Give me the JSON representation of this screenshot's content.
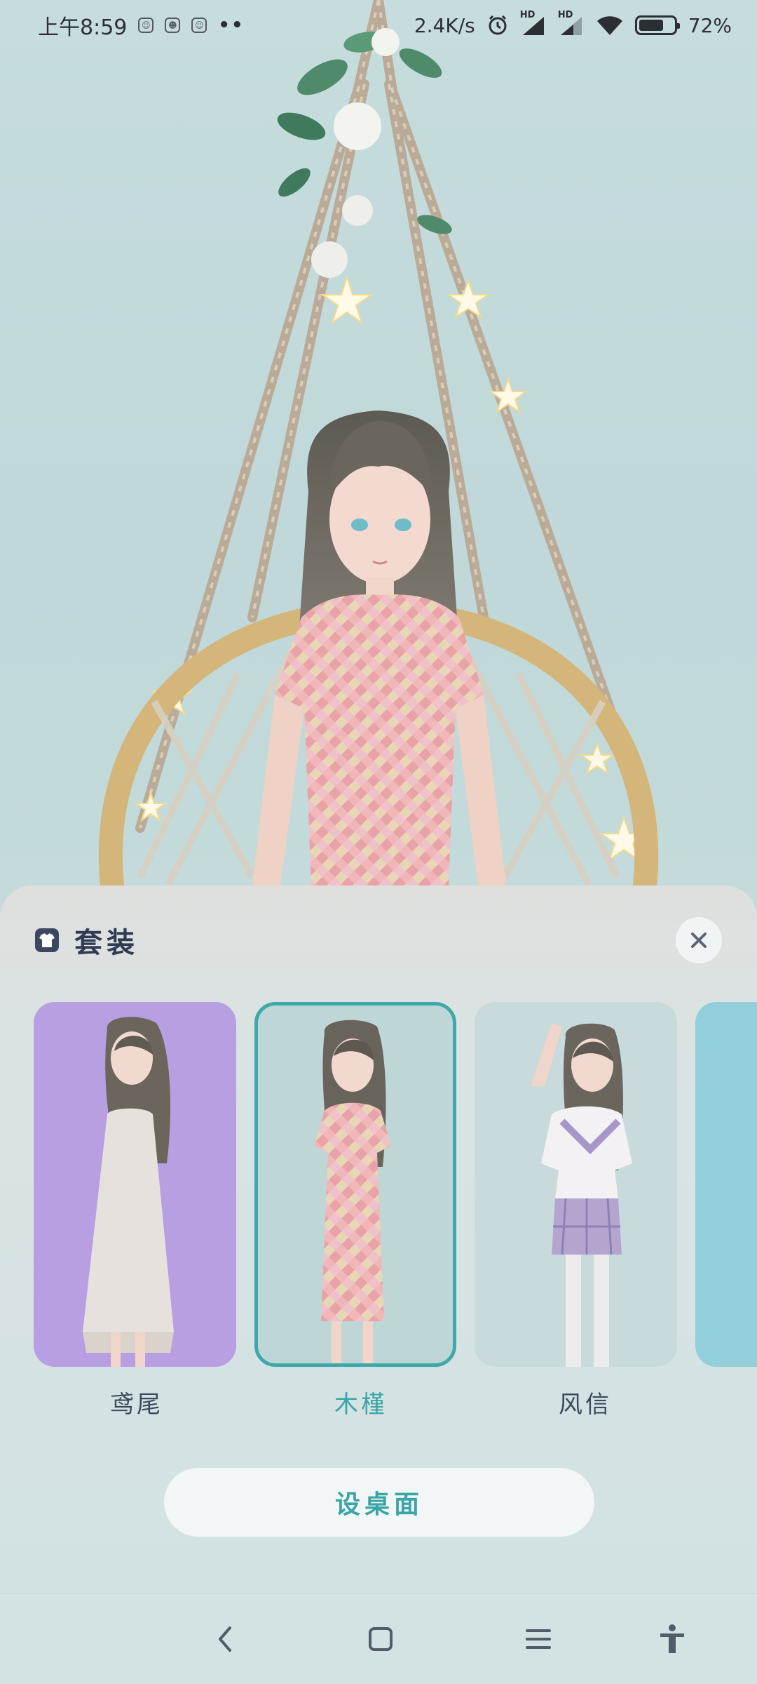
{
  "status_bar": {
    "time": "上午8:59",
    "net_speed": "2.4K/s",
    "hd_label": "HD",
    "battery_text": "72%",
    "battery_level": 0.72
  },
  "sheet": {
    "title": "套装",
    "outfits": [
      {
        "label": "鸢尾",
        "bg": "#b79fe1"
      },
      {
        "label": "木槿",
        "bg": "#bfd6d7",
        "selected": true
      },
      {
        "label": "风信",
        "bg": "#c8dadb"
      },
      {
        "label": "",
        "bg": "#93cfdb"
      }
    ],
    "set_desktop_label": "设桌面"
  },
  "icons": {
    "outfit": "outfit-icon",
    "close": "close-icon",
    "back": "back-icon",
    "home": "home-icon",
    "recents": "menu-icon",
    "accessibility": "accessibility-icon"
  },
  "colors": {
    "accent": "#3aa5a6",
    "title": "#2f3b52"
  }
}
